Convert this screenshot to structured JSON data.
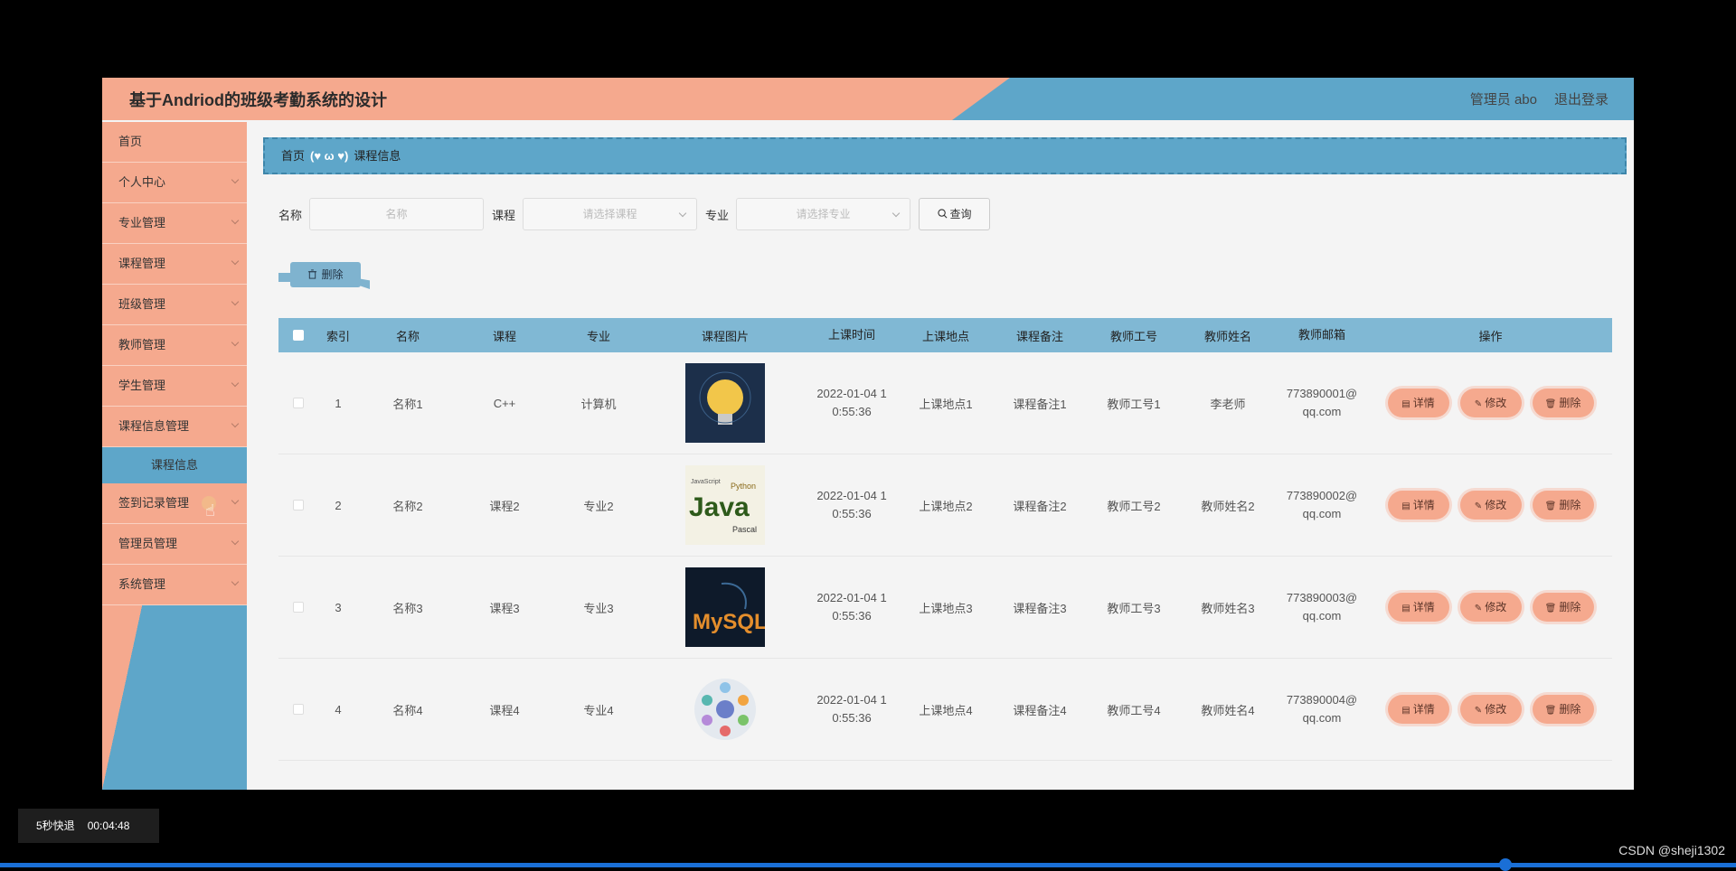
{
  "header": {
    "title": "基于Andriod的班级考勤系统的设计",
    "user": "管理员 abo",
    "logout": "退出登录"
  },
  "sidebar": {
    "items": [
      {
        "label": "首页",
        "chevron": false
      },
      {
        "label": "个人中心",
        "chevron": true
      },
      {
        "label": "专业管理",
        "chevron": true
      },
      {
        "label": "课程管理",
        "chevron": true
      },
      {
        "label": "班级管理",
        "chevron": true
      },
      {
        "label": "教师管理",
        "chevron": true
      },
      {
        "label": "学生管理",
        "chevron": true
      },
      {
        "label": "课程信息管理",
        "chevron": true
      }
    ],
    "sub_item": "课程信息",
    "items_after": [
      {
        "label": "签到记录管理",
        "chevron": true
      },
      {
        "label": "管理员管理",
        "chevron": true
      },
      {
        "label": "系统管理",
        "chevron": true
      }
    ]
  },
  "breadcrumb": {
    "home": "首页",
    "separator": "(♥ ω ♥)",
    "current": "课程信息"
  },
  "search": {
    "name_label": "名称",
    "name_placeholder": "名称",
    "course_label": "课程",
    "course_placeholder": "请选择课程",
    "major_label": "专业",
    "major_placeholder": "请选择专业",
    "query_button": "查询"
  },
  "bulk_delete_button": "删除",
  "table": {
    "headers": [
      "索引",
      "名称",
      "课程",
      "专业",
      "课程图片",
      "上课时间",
      "上课地点",
      "课程备注",
      "教师工号",
      "教师姓名",
      "教师邮箱",
      "操作"
    ],
    "rows": [
      {
        "index": "1",
        "name": "名称1",
        "course": "C++",
        "major": "计算机",
        "image": "lightbulb-image",
        "time1": "2022-01-04 1",
        "time2": "0:55:36",
        "location": "上课地点1",
        "note": "课程备注1",
        "tno": "教师工号1",
        "tname": "李老师",
        "mail1": "773890001@",
        "mail2": "qq.com"
      },
      {
        "index": "2",
        "name": "名称2",
        "course": "课程2",
        "major": "专业2",
        "image": "java-image",
        "time1": "2022-01-04 1",
        "time2": "0:55:36",
        "location": "上课地点2",
        "note": "课程备注2",
        "tno": "教师工号2",
        "tname": "教师姓名2",
        "mail1": "773890002@",
        "mail2": "qq.com"
      },
      {
        "index": "3",
        "name": "名称3",
        "course": "课程3",
        "major": "专业3",
        "image": "mysql-image",
        "time1": "2022-01-04 1",
        "time2": "0:55:36",
        "location": "上课地点3",
        "note": "课程备注3",
        "tno": "教师工号3",
        "tname": "教师姓名3",
        "mail1": "773890003@",
        "mail2": "qq.com"
      },
      {
        "index": "4",
        "name": "名称4",
        "course": "课程4",
        "major": "专业4",
        "image": "circle-diagram-image",
        "time1": "2022-01-04 1",
        "time2": "0:55:36",
        "location": "上课地点4",
        "note": "课程备注4",
        "tno": "教师工号4",
        "tname": "教师姓名4",
        "mail1": "773890004@",
        "mail2": "qq.com"
      }
    ],
    "actions": {
      "detail": "详情",
      "edit": "修改",
      "delete": "删除"
    }
  },
  "player": {
    "skip": "5秒快退",
    "time": "00:04:48"
  },
  "watermark": "CSDN @sheji1302",
  "colors": {
    "salmon": "#f5a98e",
    "blue": "#5ea6c9",
    "table_header": "#80b8d4"
  }
}
